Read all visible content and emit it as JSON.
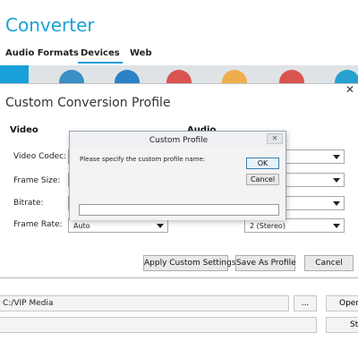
{
  "app": {
    "title": "Converter",
    "tabs": [
      "Audio Formats",
      "Devices",
      "Web"
    ],
    "active_tab": "Devices",
    "accent": "#1aa0d8"
  },
  "bottom": {
    "output_path": "C:/VIP Media",
    "browse_label": "...",
    "open_label": "Open",
    "start_label": "Sta"
  },
  "profile_dialog": {
    "title": "Custom Conversion Profile",
    "close_icon": "close-icon",
    "video": {
      "heading": "Video",
      "fields": [
        {
          "label": "Video Codec:",
          "value": ""
        },
        {
          "label": "Frame Size:",
          "value": ""
        },
        {
          "label": "Bitrate:",
          "value": ""
        },
        {
          "label": "Frame Rate:",
          "value": "Auto"
        }
      ]
    },
    "audio": {
      "heading": "Audio",
      "fields": [
        {
          "value": ""
        },
        {
          "value": ""
        },
        {
          "value": ""
        },
        {
          "value": "2 (Stereo)"
        }
      ]
    },
    "buttons": {
      "apply": "Apply Custom Settings",
      "save": "Save As Profile",
      "cancel": "Cancel"
    }
  },
  "name_dialog": {
    "title": "Custom Profile",
    "close_label": "✕",
    "prompt": "Please specify the custom profile name:",
    "ok": "OK",
    "cancel": "Cancel",
    "input_value": ""
  }
}
